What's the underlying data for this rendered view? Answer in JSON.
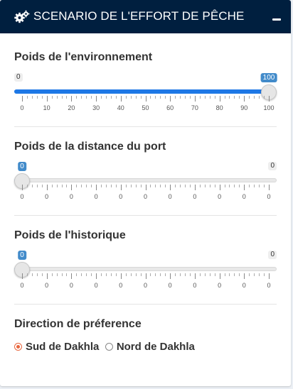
{
  "header": {
    "title": "SCENARIO DE L'EFFORT DE PÊCHE",
    "icon": "cogs-icon",
    "collapse_icon": "minus-icon",
    "background": "#001f3f"
  },
  "sliders": [
    {
      "label": "Poids de l'environnement",
      "min": 0,
      "max": 100,
      "value": 100,
      "ticks": [
        "0",
        "10",
        "20",
        "30",
        "40",
        "50",
        "60",
        "70",
        "80",
        "90",
        "100"
      ]
    },
    {
      "label": "Poids de la distance du port",
      "min": 0,
      "max": 0,
      "value": 0,
      "ticks": [
        "0",
        "0",
        "0",
        "0",
        "0",
        "0",
        "0",
        "0",
        "0",
        "0",
        "0"
      ]
    },
    {
      "label": "Poids de l'historique",
      "min": 0,
      "max": 0,
      "value": 0,
      "ticks": [
        "0",
        "0",
        "0",
        "0",
        "0",
        "0",
        "0",
        "0",
        "0",
        "0",
        "0"
      ]
    }
  ],
  "direction": {
    "label": "Direction de préference",
    "options": [
      {
        "label": "Sud de Dakhla",
        "checked": true
      },
      {
        "label": "Nord de Dakhla",
        "checked": false
      }
    ],
    "accent": "#e8663d"
  },
  "colors": {
    "slider_fill": "#1e78e6",
    "value_badge": "#428bca"
  }
}
